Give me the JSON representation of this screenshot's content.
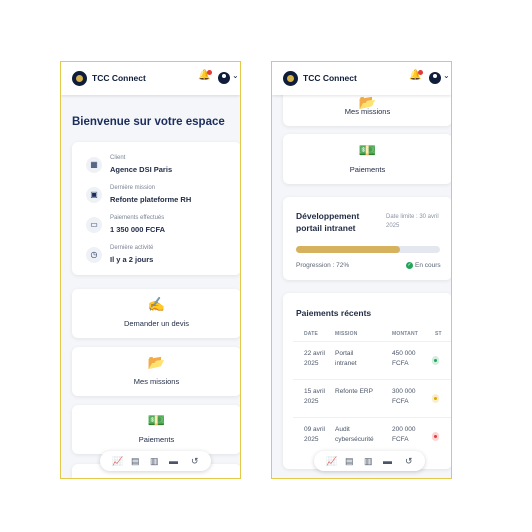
{
  "app": {
    "brand": "TCC Connect"
  },
  "left": {
    "welcome": "Bienvenue sur votre espace",
    "info": [
      {
        "label": "Client",
        "value": "Agence DSI Paris",
        "icon": "building-icon"
      },
      {
        "label": "Dernière mission",
        "value": "Refonte plateforme RH",
        "icon": "briefcase-icon"
      },
      {
        "label": "Paiements effectués",
        "value": "1 350 000 FCFA",
        "icon": "card-icon"
      },
      {
        "label": "Dernière activité",
        "value": "Il y a 2 jours",
        "icon": "clock-icon"
      }
    ],
    "actions": [
      {
        "label": "Demander un devis",
        "icon": "signature-icon"
      },
      {
        "label": "Mes missions",
        "icon": "folder-icon"
      },
      {
        "label": "Paiements",
        "icon": "money-icon"
      }
    ]
  },
  "right": {
    "actions": [
      {
        "label": "Mes missions",
        "icon": "folder-icon"
      },
      {
        "label": "Paiements",
        "icon": "money-icon"
      }
    ],
    "project": {
      "title": "Développement portail intranet",
      "deadline": "Date limite : 30 avril 2025",
      "progress_label": "Progression : 72%",
      "progress": 0.72,
      "status": "En cours"
    },
    "payments": {
      "title": "Paiements récents",
      "headers": [
        "DATE",
        "MISSION",
        "MONTANT",
        "ST"
      ],
      "rows": [
        {
          "date": "22 avril 2025",
          "mission": "Portail intranet",
          "amount": "450 000 FCFA",
          "status_color": "#22a45d"
        },
        {
          "date": "15 avril 2025",
          "mission": "Refonte ERP",
          "amount": "300 000 FCFA",
          "status_color": "#e0a800"
        },
        {
          "date": "09 avril 2025",
          "mission": "Audit cybersécurité",
          "amount": "200 000 FCFA",
          "status_color": "#e53935"
        }
      ]
    }
  },
  "nav": [
    "chart-icon",
    "document-icon",
    "clipboard-icon",
    "id-card-icon",
    "history-icon"
  ],
  "colors": {
    "accent": "#d7b25e",
    "navy": "#1b2d5b",
    "frame": "#e3c84a"
  }
}
